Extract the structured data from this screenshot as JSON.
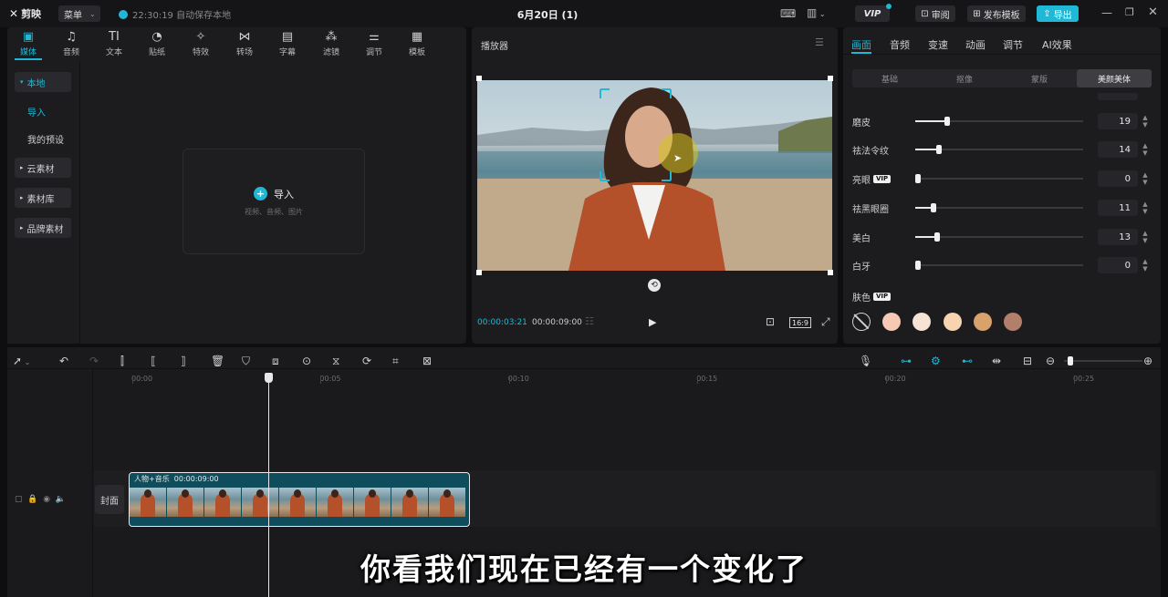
{
  "titlebar": {
    "logo": "剪映",
    "menu_label": "菜单",
    "save_status": "22:30:19 自动保存本地",
    "project_title": "6月20日 (1)",
    "vip_label": "VIP",
    "review_label": "审阅",
    "publish_template_label": "发布模板",
    "export_label": "导出"
  },
  "media_toolbar": [
    {
      "label": "媒体",
      "icon": "media-icon",
      "glyph": "▣"
    },
    {
      "label": "音频",
      "icon": "audio-icon",
      "glyph": "♫"
    },
    {
      "label": "文本",
      "icon": "text-icon",
      "glyph": "TI"
    },
    {
      "label": "贴纸",
      "icon": "sticker-icon",
      "glyph": "◔"
    },
    {
      "label": "特效",
      "icon": "effects-icon",
      "glyph": "✧"
    },
    {
      "label": "转场",
      "icon": "transition-icon",
      "glyph": "⋈"
    },
    {
      "label": "字幕",
      "icon": "caption-icon",
      "glyph": "▤"
    },
    {
      "label": "滤镜",
      "icon": "filter-icon",
      "glyph": "⁂"
    },
    {
      "label": "调节",
      "icon": "adjust-icon",
      "glyph": "⚌"
    },
    {
      "label": "模板",
      "icon": "template-icon",
      "glyph": "▦"
    }
  ],
  "sidebar": {
    "local": "本地",
    "import": "导入",
    "my_presets": "我的预设",
    "cloud": "云素材",
    "library": "素材库",
    "brand": "品牌素材"
  },
  "import_box": {
    "label": "导入",
    "hint": "视频、音频、图片"
  },
  "player": {
    "title": "播放器",
    "current_time": "00:00:03:21",
    "total_time": "00:00:09:00",
    "ratio": "16:9"
  },
  "props": {
    "tabs": [
      "画面",
      "音频",
      "变速",
      "动画",
      "调节",
      "AI效果"
    ],
    "segments": [
      "基础",
      "抠像",
      "蒙版",
      "美颜美体"
    ],
    "sliders": [
      {
        "label": "磨皮",
        "value": 19,
        "vip": false
      },
      {
        "label": "祛法令纹",
        "value": 14,
        "vip": false
      },
      {
        "label": "亮眼",
        "value": 0,
        "vip": true
      },
      {
        "label": "祛黑眼圈",
        "value": 11,
        "vip": false
      },
      {
        "label": "美白",
        "value": 13,
        "vip": false
      },
      {
        "label": "白牙",
        "value": 0,
        "vip": false
      }
    ],
    "skin_label": "肤色",
    "vip_tag": "VIP",
    "swatches": [
      "#f5c9b3",
      "#f7e3d3",
      "#f8d3b0",
      "#d9a16c",
      "#b2806a"
    ]
  },
  "timeline": {
    "ruler": [
      "00:00",
      "00:05",
      "00:10",
      "00:15",
      "00:20",
      "00:25"
    ],
    "clip_title": "人物+音乐",
    "clip_duration": "00:00:09:00",
    "cover_label": "封面"
  },
  "subtitle": "你看我们现在已经有一个变化了"
}
